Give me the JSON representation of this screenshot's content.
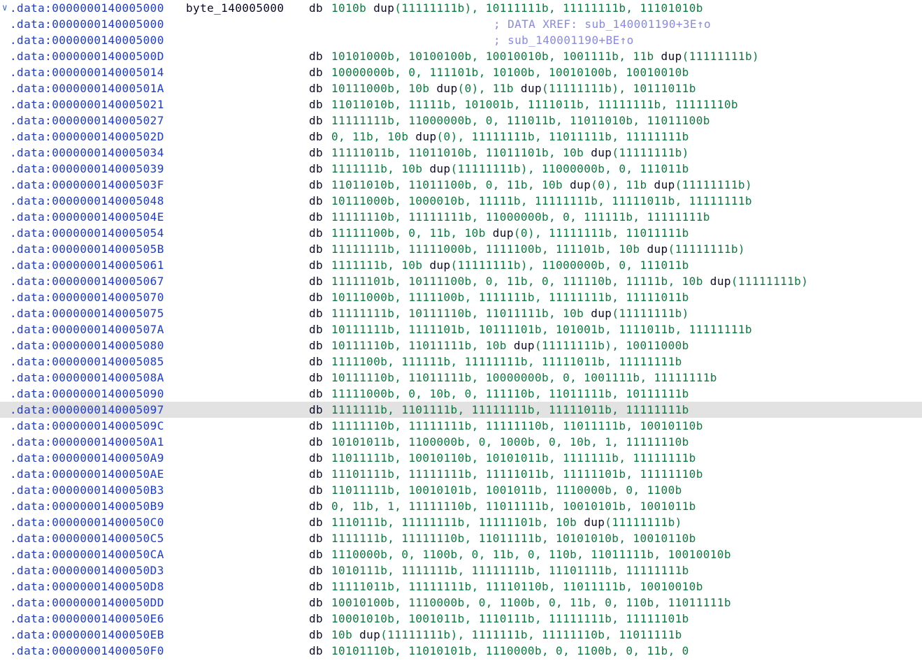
{
  "disassembly": {
    "collapse_glyph": "chevron-down",
    "lines": [
      {
        "addr": ".data:0000000140005000",
        "label": "byte_140005000",
        "mnem": "db",
        "ops": "1010b dup(11111111b), 10111111b, 11111111b, 11101010b",
        "comment": ""
      },
      {
        "addr": ".data:0000000140005000",
        "label": "",
        "mnem": "",
        "ops": "",
        "comment": "; DATA XREF: sub_140001190+3E↑o"
      },
      {
        "addr": ".data:0000000140005000",
        "label": "",
        "mnem": "",
        "ops": "",
        "comment": "; sub_140001190+BE↑o"
      },
      {
        "addr": ".data:000000014000500D",
        "label": "",
        "mnem": "db",
        "ops": "10101000b, 10100100b, 10010010b, 1001111b, 11b dup(11111111b)",
        "comment": ""
      },
      {
        "addr": ".data:0000000140005014",
        "label": "",
        "mnem": "db",
        "ops": "10000000b, 0, 111101b, 10100b, 10010100b, 10010010b",
        "comment": ""
      },
      {
        "addr": ".data:000000014000501A",
        "label": "",
        "mnem": "db",
        "ops": "10111000b, 10b dup(0), 11b dup(11111111b), 10111011b",
        "comment": ""
      },
      {
        "addr": ".data:0000000140005021",
        "label": "",
        "mnem": "db",
        "ops": "11011010b, 11111b, 101001b, 1111011b, 11111111b, 11111110b",
        "comment": ""
      },
      {
        "addr": ".data:0000000140005027",
        "label": "",
        "mnem": "db",
        "ops": "11111111b, 11000000b, 0, 111011b, 11011010b, 11011100b",
        "comment": ""
      },
      {
        "addr": ".data:000000014000502D",
        "label": "",
        "mnem": "db",
        "ops": "0, 11b, 10b dup(0), 11111111b, 11011111b, 11111111b",
        "comment": ""
      },
      {
        "addr": ".data:0000000140005034",
        "label": "",
        "mnem": "db",
        "ops": "11111011b, 11011010b, 11011101b, 10b dup(11111111b)",
        "comment": ""
      },
      {
        "addr": ".data:0000000140005039",
        "label": "",
        "mnem": "db",
        "ops": "1111111b, 10b dup(11111111b), 11000000b, 0, 111011b",
        "comment": ""
      },
      {
        "addr": ".data:000000014000503F",
        "label": "",
        "mnem": "db",
        "ops": "11011010b, 11011100b, 0, 11b, 10b dup(0), 11b dup(11111111b)",
        "comment": ""
      },
      {
        "addr": ".data:0000000140005048",
        "label": "",
        "mnem": "db",
        "ops": "10111000b, 1000010b, 11111b, 11111111b, 11111011b, 11111111b",
        "comment": ""
      },
      {
        "addr": ".data:000000014000504E",
        "label": "",
        "mnem": "db",
        "ops": "11111110b, 11111111b, 11000000b, 0, 111111b, 11111111b",
        "comment": ""
      },
      {
        "addr": ".data:0000000140005054",
        "label": "",
        "mnem": "db",
        "ops": "11111100b, 0, 11b, 10b dup(0), 11111111b, 11011111b",
        "comment": ""
      },
      {
        "addr": ".data:000000014000505B",
        "label": "",
        "mnem": "db",
        "ops": "11111111b, 11111000b, 1111100b, 111101b, 10b dup(11111111b)",
        "comment": ""
      },
      {
        "addr": ".data:0000000140005061",
        "label": "",
        "mnem": "db",
        "ops": "1111111b, 10b dup(11111111b), 11000000b, 0, 111011b",
        "comment": ""
      },
      {
        "addr": ".data:0000000140005067",
        "label": "",
        "mnem": "db",
        "ops": "11111101b, 10111100b, 0, 11b, 0, 111110b, 11111b, 10b dup(11111111b)",
        "comment": ""
      },
      {
        "addr": ".data:0000000140005070",
        "label": "",
        "mnem": "db",
        "ops": "10111000b, 1111100b, 1111111b, 11111111b, 11111011b",
        "comment": ""
      },
      {
        "addr": ".data:0000000140005075",
        "label": "",
        "mnem": "db",
        "ops": "11111111b, 10111110b, 11011111b, 10b dup(11111111b)",
        "comment": ""
      },
      {
        "addr": ".data:000000014000507A",
        "label": "",
        "mnem": "db",
        "ops": "10111111b, 1111101b, 10111101b, 101001b, 1111011b, 11111111b",
        "comment": ""
      },
      {
        "addr": ".data:0000000140005080",
        "label": "",
        "mnem": "db",
        "ops": "10111110b, 11011111b, 10b dup(11111111b), 10011000b",
        "comment": ""
      },
      {
        "addr": ".data:0000000140005085",
        "label": "",
        "mnem": "db",
        "ops": "1111100b, 111111b, 11111111b, 11111011b, 11111111b",
        "comment": ""
      },
      {
        "addr": ".data:000000014000508A",
        "label": "",
        "mnem": "db",
        "ops": "10111110b, 11011111b, 10000000b, 0, 1001111b, 11111111b",
        "comment": ""
      },
      {
        "addr": ".data:0000000140005090",
        "label": "",
        "mnem": "db",
        "ops": "11111000b, 0, 10b, 0, 111110b, 11011111b, 10111111b",
        "comment": ""
      },
      {
        "addr": ".data:0000000140005097",
        "label": "",
        "mnem": "db",
        "ops": "1111111b, 1101111b, 11111111b, 11111011b, 11111111b",
        "comment": "",
        "highlight": true
      },
      {
        "addr": ".data:000000014000509C",
        "label": "",
        "mnem": "db",
        "ops": "11111110b, 11111111b, 11111110b, 11011111b, 10010110b",
        "comment": ""
      },
      {
        "addr": ".data:00000001400050A1",
        "label": "",
        "mnem": "db",
        "ops": "10101011b, 1100000b, 0, 1000b, 0, 10b, 1, 11111110b",
        "comment": ""
      },
      {
        "addr": ".data:00000001400050A9",
        "label": "",
        "mnem": "db",
        "ops": "11011111b, 10010110b, 10101011b, 1111111b, 11111111b",
        "comment": ""
      },
      {
        "addr": ".data:00000001400050AE",
        "label": "",
        "mnem": "db",
        "ops": "11101111b, 11111111b, 11111011b, 11111101b, 11111110b",
        "comment": ""
      },
      {
        "addr": ".data:00000001400050B3",
        "label": "",
        "mnem": "db",
        "ops": "11011111b, 10010101b, 1001011b, 1110000b, 0, 1100b",
        "comment": ""
      },
      {
        "addr": ".data:00000001400050B9",
        "label": "",
        "mnem": "db",
        "ops": "0, 11b, 1, 11111110b, 11011111b, 10010101b, 1001011b",
        "comment": ""
      },
      {
        "addr": ".data:00000001400050C0",
        "label": "",
        "mnem": "db",
        "ops": "1110111b, 11111111b, 11111101b, 10b dup(11111111b)",
        "comment": ""
      },
      {
        "addr": ".data:00000001400050C5",
        "label": "",
        "mnem": "db",
        "ops": "1111111b, 11111110b, 11011111b, 10101010b, 10010110b",
        "comment": ""
      },
      {
        "addr": ".data:00000001400050CA",
        "label": "",
        "mnem": "db",
        "ops": "1110000b, 0, 1100b, 0, 11b, 0, 110b, 11011111b, 10010010b",
        "comment": ""
      },
      {
        "addr": ".data:00000001400050D3",
        "label": "",
        "mnem": "db",
        "ops": "1010111b, 1111111b, 11111111b, 11101111b, 11111111b",
        "comment": ""
      },
      {
        "addr": ".data:00000001400050D8",
        "label": "",
        "mnem": "db",
        "ops": "11111011b, 11111111b, 11110110b, 11011111b, 10010010b",
        "comment": ""
      },
      {
        "addr": ".data:00000001400050DD",
        "label": "",
        "mnem": "db",
        "ops": "10010100b, 1110000b, 0, 1100b, 0, 11b, 0, 110b, 11011111b",
        "comment": ""
      },
      {
        "addr": ".data:00000001400050E6",
        "label": "",
        "mnem": "db",
        "ops": "10001010b, 1001011b, 1110111b, 11111111b, 11111101b",
        "comment": ""
      },
      {
        "addr": ".data:00000001400050EB",
        "label": "",
        "mnem": "db",
        "ops": "10b dup(11111111b), 1111111b, 11111110b, 11011111b",
        "comment": ""
      },
      {
        "addr": ".data:00000001400050F0",
        "label": "",
        "mnem": "db",
        "ops": "10101110b, 11010101b, 1110000b, 0, 1100b, 0, 11b, 0",
        "comment": ""
      }
    ]
  }
}
